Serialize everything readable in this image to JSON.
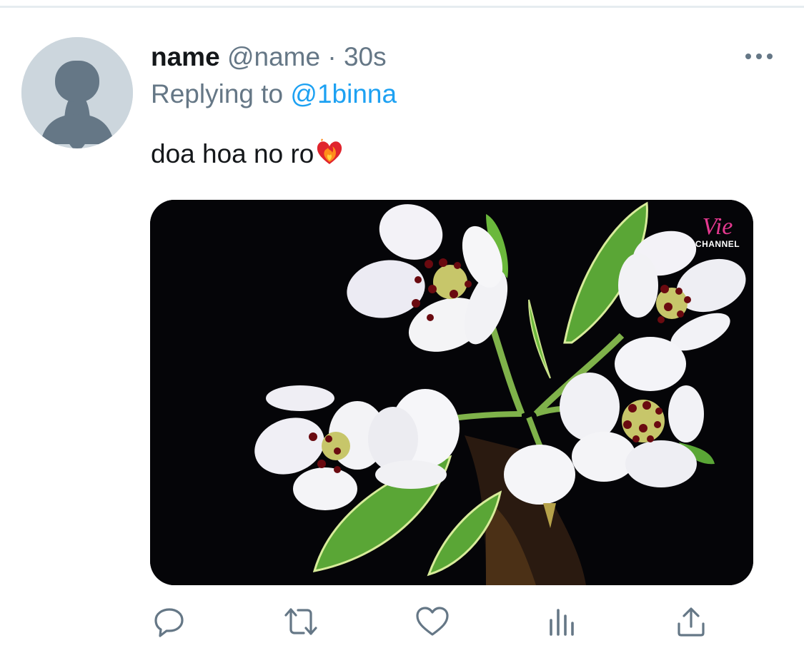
{
  "tweet": {
    "display_name": "name",
    "handle": "@name",
    "separator": "·",
    "time": "30s",
    "replying_prefix": "Replying to",
    "replying_handle": "@1binna",
    "text": "doa hoa no ro",
    "text_emoji": "heart-on-fire-emoji"
  },
  "media": {
    "watermark_brand": "Vie",
    "watermark_sub": "CHANNEL"
  },
  "actions": [
    "reply-icon",
    "retweet-icon",
    "like-icon",
    "analytics-icon",
    "share-icon"
  ],
  "colors": {
    "link": "#1da1f2",
    "secondary_text": "#657786",
    "primary_text": "#14171a",
    "avatar_bg": "#ccd6dd",
    "divider": "#e6ecf0",
    "watermark": "#e4398f"
  }
}
